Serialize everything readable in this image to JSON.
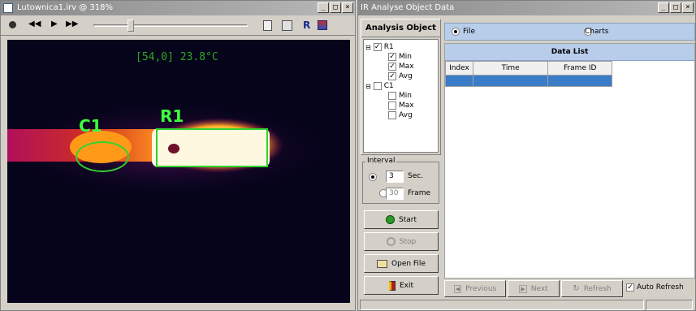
{
  "left_window": {
    "title": "Lutownica1.irv @ 318%",
    "temperature_readout": "[54,0] 23.8°C",
    "labels": {
      "c1": "C1",
      "r1": "R1"
    }
  },
  "right_window": {
    "title": "IR Analyse Object Data",
    "analysis_header": "Analysis Object",
    "tree": {
      "r1": {
        "label": "R1",
        "checked": true,
        "children": [
          {
            "label": "Min",
            "checked": true
          },
          {
            "label": "Max",
            "checked": true
          },
          {
            "label": "Avg",
            "checked": true
          }
        ]
      },
      "c1": {
        "label": "C1",
        "checked": false,
        "children": [
          {
            "label": "Min",
            "checked": false
          },
          {
            "label": "Max",
            "checked": false
          },
          {
            "label": "Avg",
            "checked": false
          }
        ]
      }
    },
    "interval": {
      "legend": "Interval",
      "seconds_value": "3",
      "seconds_label": "Sec.",
      "frames_value": "30",
      "frames_label": "Frame"
    },
    "buttons": {
      "start": "Start",
      "stop": "Stop",
      "open_file": "Open File",
      "exit": "Exit"
    },
    "view_options": {
      "file": "File",
      "charts": "Charts"
    },
    "data_list": {
      "title": "Data List",
      "columns": [
        "Index",
        "Time",
        "Frame ID"
      ]
    },
    "bottom_bar": {
      "previous": "Previous",
      "next": "Next",
      "refresh": "Refresh",
      "auto_refresh": "Auto Refresh"
    }
  }
}
